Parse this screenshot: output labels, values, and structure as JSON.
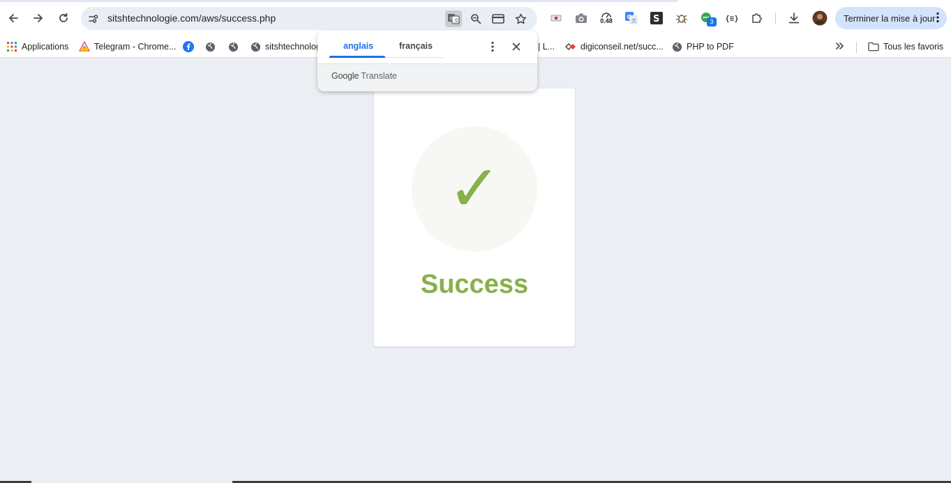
{
  "browser": {
    "url": "sitshtechnologie.com/aws/success.php",
    "update_button": "Terminer la mise à jour",
    "speed_badge": "0.48",
    "notification_count": "3",
    "colors": {
      "accent": "#1a73e8",
      "update_bg": "#d3e3fd",
      "omnibox_bg": "#e9eef6"
    }
  },
  "bookmarks": {
    "items": [
      {
        "label": "Applications",
        "icon": "apps-grid-icon"
      },
      {
        "label": "Telegram - Chrome...",
        "icon": "telegram-icon"
      },
      {
        "label": "",
        "icon": "facebook-icon"
      },
      {
        "label": "",
        "icon": "globe-icon"
      },
      {
        "label": "",
        "icon": "globe-icon"
      },
      {
        "label": "sitshtechnolog",
        "icon": "globe-icon"
      },
      {
        "label": "| L...",
        "icon": ""
      },
      {
        "label": "digiconseil.net/succ...",
        "icon": "digiconseil-icon"
      },
      {
        "label": "PHP to PDF",
        "icon": "globe-icon"
      }
    ],
    "all_bookmarks": "Tous les favoris"
  },
  "translate_popup": {
    "tabs": [
      "anglais",
      "français"
    ],
    "active_tab": "anglais",
    "brand_google": "Google",
    "brand_product": "Translate"
  },
  "page": {
    "status_title": "Success",
    "status_icon": "checkmark-icon",
    "check_glyph": "✓",
    "colors": {
      "success": "#88b04b",
      "circle_bg": "#f7f8f3",
      "page_bg": "#ebeff3"
    }
  }
}
